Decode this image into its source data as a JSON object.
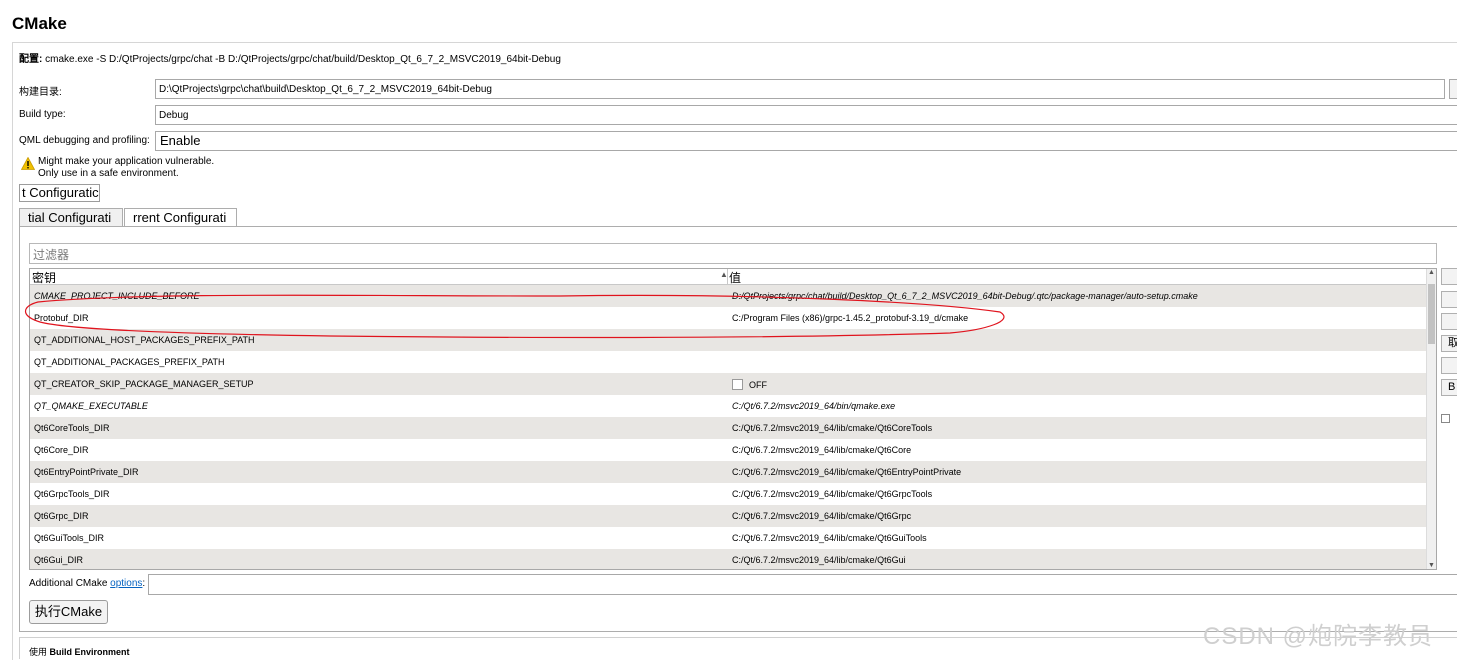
{
  "header": {
    "title": "CMake"
  },
  "config": {
    "prefix": "配置:",
    "command": " cmake.exe -S D:/QtProjects/grpc/chat -B D:/QtProjects/grpc/chat/build/Desktop_Qt_6_7_2_MSVC2019_64bit-Debug"
  },
  "build_dir": {
    "label": "构建目录:",
    "value": "D:\\QtProjects\\grpc\\chat\\build\\Desktop_Qt_6_7_2_MSVC2019_64bit-Debug"
  },
  "build_type": {
    "label": "Build type:",
    "value": "Debug"
  },
  "qml": {
    "label": "QML debugging and profiling:",
    "value": "Enable"
  },
  "warning": {
    "line1": "Might make your application vulnerable.",
    "line2": "Only use in a safe environment."
  },
  "config_button": "t Configuratic",
  "tabs": [
    {
      "label": "tial Configurati",
      "active": false
    },
    {
      "label": "rrent Configurati",
      "active": true
    }
  ],
  "filter": {
    "placeholder": "过滤器"
  },
  "table": {
    "col_key": "密钥",
    "col_value": "值",
    "rows": [
      {
        "key": "CMAKE_PROJECT_INCLUDE_BEFORE",
        "value": "D:/QtProjects/grpc/chat/build/Desktop_Qt_6_7_2_MSVC2019_64bit-Debug/.qtc/package-manager/auto-setup.cmake",
        "italic": true
      },
      {
        "key": "Protobuf_DIR",
        "value": "C:/Program Files (x86)/grpc-1.45.2_protobuf-3.19_d/cmake",
        "italic": false
      },
      {
        "key": "QT_ADDITIONAL_HOST_PACKAGES_PREFIX_PATH",
        "value": "",
        "italic": false
      },
      {
        "key": "QT_ADDITIONAL_PACKAGES_PREFIX_PATH",
        "value": "",
        "italic": false
      },
      {
        "key": "QT_CREATOR_SKIP_PACKAGE_MANAGER_SETUP",
        "value": "OFF",
        "italic": false,
        "checkbox": true
      },
      {
        "key": "QT_QMAKE_EXECUTABLE",
        "value": "C:/Qt/6.7.2/msvc2019_64/bin/qmake.exe",
        "italic": true
      },
      {
        "key": "Qt6CoreTools_DIR",
        "value": "C:/Qt/6.7.2/msvc2019_64/lib/cmake/Qt6CoreTools",
        "italic": false
      },
      {
        "key": "Qt6Core_DIR",
        "value": "C:/Qt/6.7.2/msvc2019_64/lib/cmake/Qt6Core",
        "italic": false
      },
      {
        "key": "Qt6EntryPointPrivate_DIR",
        "value": "C:/Qt/6.7.2/msvc2019_64/lib/cmake/Qt6EntryPointPrivate",
        "italic": false
      },
      {
        "key": "Qt6GrpcTools_DIR",
        "value": "C:/Qt/6.7.2/msvc2019_64/lib/cmake/Qt6GrpcTools",
        "italic": false
      },
      {
        "key": "Qt6Grpc_DIR",
        "value": "C:/Qt/6.7.2/msvc2019_64/lib/cmake/Qt6Grpc",
        "italic": false
      },
      {
        "key": "Qt6GuiTools_DIR",
        "value": "C:/Qt/6.7.2/msvc2019_64/lib/cmake/Qt6GuiTools",
        "italic": false
      },
      {
        "key": "Qt6Gui_DIR",
        "value": "C:/Qt/6.7.2/msvc2019_64/lib/cmake/Qt6Gui",
        "italic": false
      }
    ]
  },
  "side_buttons": [
    "",
    "",
    "",
    "取",
    "",
    "B"
  ],
  "additional": {
    "label": "Additional CMake ",
    "link": "options",
    "colon": ":"
  },
  "run_button": "执行CMake",
  "env": {
    "prefix": "使用",
    "label": "Build Environment"
  },
  "watermark": "CSDN @炮院李教员",
  "colors": {
    "alt_row": "#e8e6e3",
    "annotation": "#e0141e",
    "link": "#0563c1",
    "warning": "#f0c000"
  },
  "icons": {
    "warning": "warning-triangle-icon",
    "sort": "sort-up-icon"
  }
}
